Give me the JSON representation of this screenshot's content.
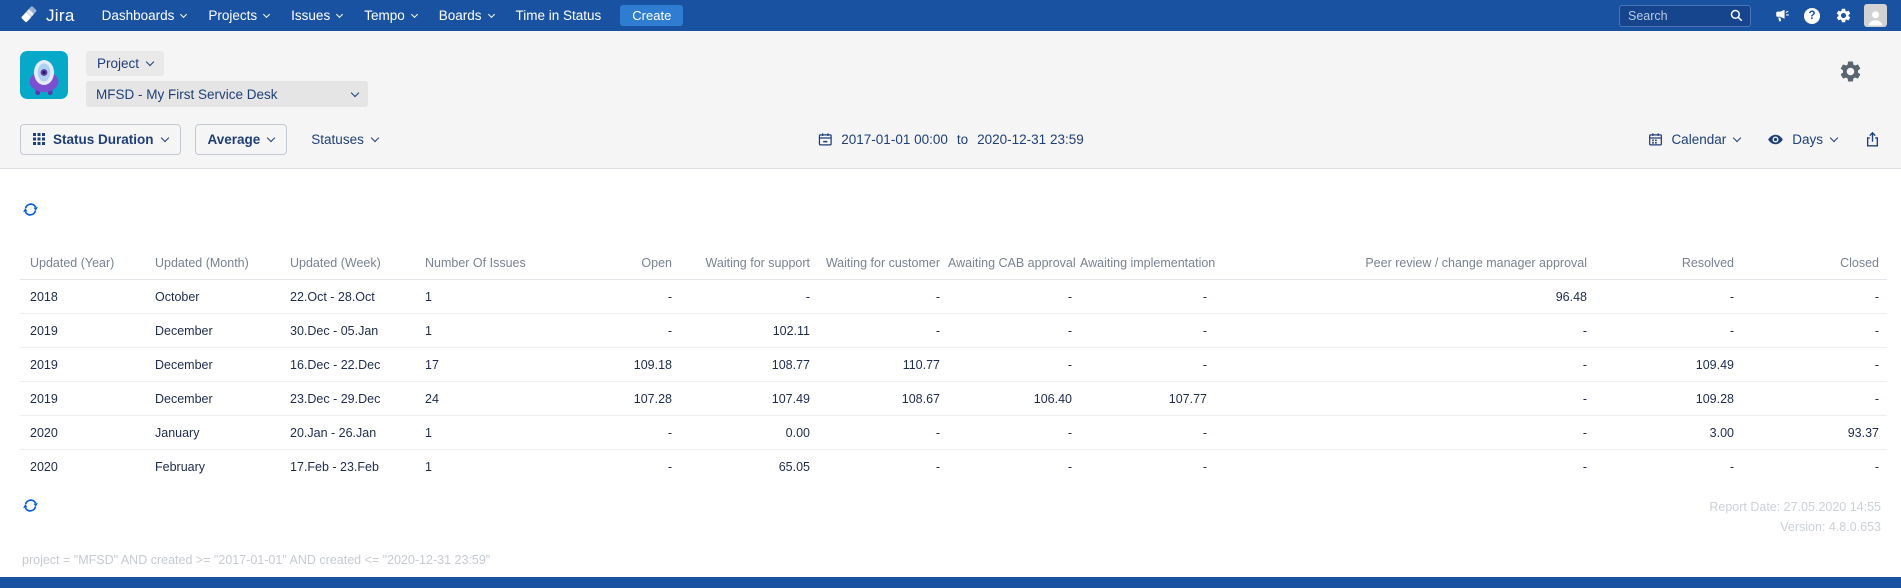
{
  "navbar": {
    "brand": "Jira",
    "items": [
      {
        "label": "Dashboards",
        "dropdown": true
      },
      {
        "label": "Projects",
        "dropdown": true
      },
      {
        "label": "Issues",
        "dropdown": true
      },
      {
        "label": "Tempo",
        "dropdown": true
      },
      {
        "label": "Boards",
        "dropdown": true
      },
      {
        "label": "Time in Status",
        "dropdown": false
      }
    ],
    "create_label": "Create",
    "search_placeholder": "Search"
  },
  "project": {
    "scope_label": "Project",
    "selected": "MFSD - My First Service Desk"
  },
  "toolbar": {
    "report_type": "Status Duration",
    "aggregation": "Average",
    "statuses_label": "Statuses",
    "date_from": "2017-01-01 00:00",
    "date_separator": "to",
    "date_to": "2020-12-31 23:59",
    "view_mode": "Calendar",
    "unit": "Days"
  },
  "table": {
    "columns": [
      "Updated (Year)",
      "Updated (Month)",
      "Updated (Week)",
      "Number Of Issues",
      "Open",
      "Waiting for support",
      "Waiting for customer",
      "Awaiting CAB approval",
      "Awaiting implementation",
      "Peer review / change manager approval",
      "Resolved",
      "Closed"
    ],
    "rows": [
      [
        "2018",
        "October",
        "22.Oct - 28.Oct",
        "1",
        "-",
        "-",
        "-",
        "-",
        "-",
        "96.48",
        "-",
        "-"
      ],
      [
        "2019",
        "December",
        "30.Dec - 05.Jan",
        "1",
        "-",
        "102.11",
        "-",
        "-",
        "-",
        "-",
        "-",
        "-"
      ],
      [
        "2019",
        "December",
        "16.Dec - 22.Dec",
        "17",
        "109.18",
        "108.77",
        "110.77",
        "-",
        "-",
        "-",
        "109.49",
        "-"
      ],
      [
        "2019",
        "December",
        "23.Dec - 29.Dec",
        "24",
        "107.28",
        "107.49",
        "108.67",
        "106.40",
        "107.77",
        "-",
        "109.28",
        "-"
      ],
      [
        "2020",
        "January",
        "20.Jan - 26.Jan",
        "1",
        "-",
        "0.00",
        "-",
        "-",
        "-",
        "-",
        "3.00",
        "93.37"
      ],
      [
        "2020",
        "February",
        "17.Feb - 23.Feb",
        "1",
        "-",
        "65.05",
        "-",
        "-",
        "-",
        "-",
        "-",
        "-"
      ]
    ]
  },
  "footer": {
    "report_date": "Report Date: 27.05.2020 14:55",
    "version": "Version: 4.8.0.653",
    "query": "project = \"MFSD\" AND created >= \"2017-01-01\" AND created <= \"2020-12-31 23:59\""
  },
  "icons": {
    "navbar_right": [
      "announcement-icon",
      "help-icon",
      "settings-icon",
      "user-avatar"
    ],
    "toolbar": [
      "grid-icon",
      "calendar-icon",
      "eye-icon",
      "export-icon"
    ],
    "content": [
      "refresh-icon"
    ]
  },
  "colors": {
    "navbar_blue": "#1a52a2",
    "create_button_blue": "#2e7dd1",
    "refresh_icon_blue": "#0b5cd7",
    "control_text_navy": "#1f3f77",
    "project_avatar_teal": "#07a9c9",
    "project_avatar_purple": "#7c4fd0",
    "header_area_gray": "#f5f5f5"
  }
}
